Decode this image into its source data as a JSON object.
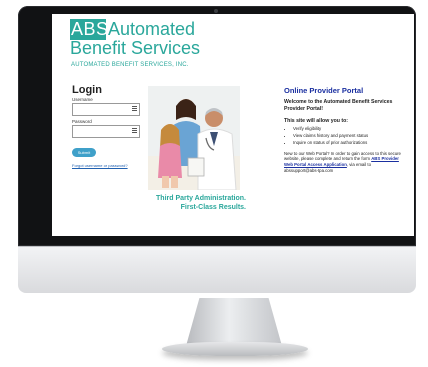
{
  "brand": {
    "logo_abs": "ABS",
    "logo_line1": "Automated",
    "logo_line2": "Benefit Services",
    "logo_sub": "AUTOMATED BENEFIT SERVICES, INC.",
    "color": "#2aa79b"
  },
  "login": {
    "title": "Login",
    "username_label": "Username",
    "password_label": "Password",
    "submit_label": "Submit",
    "forgot_link": "Forgot username or password?"
  },
  "tagline": {
    "line1": "Third Party Administration.",
    "line2": "First-Class Results."
  },
  "portal": {
    "title": "Online Provider Portal",
    "welcome": "Welcome to the Automated Benefit Services Provider Portal!",
    "allow_heading": "This site will allow you to:",
    "items": [
      "Verify eligibility",
      "View claims history and payment status",
      "Inquire on status of prior authorizations"
    ],
    "note_before": "New to our Web Portal? In order to gain access to this secure website, please complete and return the form ",
    "note_link": "ABS Provider Web Portal Access Application",
    "note_after": ", via email to abssupport@abs-tpa.com"
  }
}
